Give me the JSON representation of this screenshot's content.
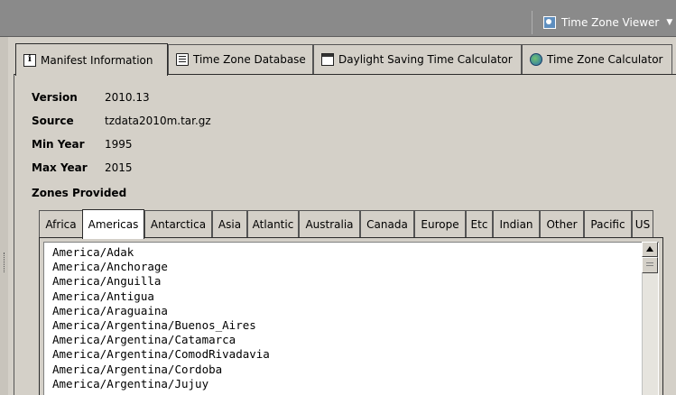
{
  "toolbar": {
    "viewer_label": "Time Zone Viewer"
  },
  "main_tabs": [
    {
      "label": "Manifest Information",
      "icon": "info-icon",
      "active": true
    },
    {
      "label": "Time Zone Database",
      "icon": "database-icon",
      "active": false
    },
    {
      "label": "Daylight Saving Time Calculator",
      "icon": "calendar-icon",
      "active": false
    },
    {
      "label": "Time Zone Calculator",
      "icon": "globe-icon",
      "active": false
    }
  ],
  "manifest": {
    "version": {
      "label": "Version",
      "value": "2010.13"
    },
    "source": {
      "label": "Source",
      "value": "tzdata2010m.tar.gz"
    },
    "min_year": {
      "label": "Min Year",
      "value": "1995"
    },
    "max_year": {
      "label": "Max Year",
      "value": "2015"
    },
    "zones_heading": "Zones Provided"
  },
  "zone_tabs": [
    "Africa",
    "Americas",
    "Antarctica",
    "Asia",
    "Atlantic",
    "Australia",
    "Canada",
    "Europe",
    "Etc",
    "Indian",
    "Other",
    "Pacific",
    "US"
  ],
  "active_zone_tab": "Americas",
  "zones": [
    "America/Adak",
    "America/Anchorage",
    "America/Anguilla",
    "America/Antigua",
    "America/Araguaina",
    "America/Argentina/Buenos_Aires",
    "America/Argentina/Catamarca",
    "America/Argentina/ComodRivadavia",
    "America/Argentina/Cordoba",
    "America/Argentina/Jujuy"
  ]
}
